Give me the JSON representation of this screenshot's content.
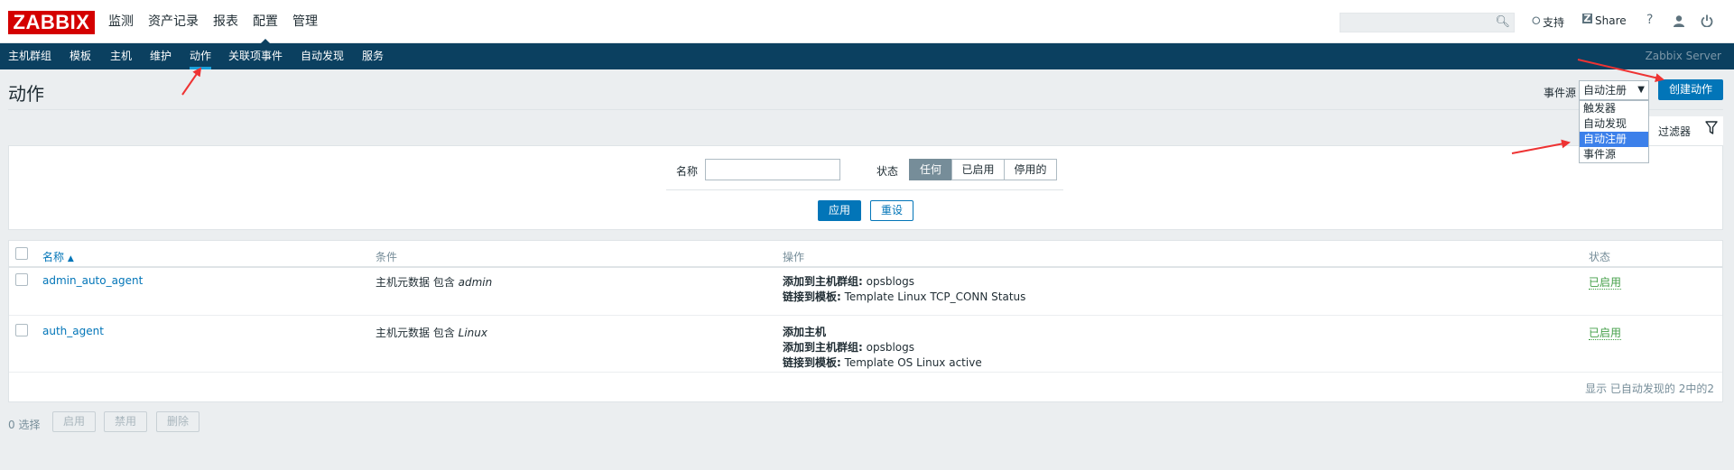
{
  "header": {
    "logo": "ZABBIX",
    "nav": [
      "监测",
      "资产记录",
      "报表",
      "配置",
      "管理"
    ],
    "active_nav": "配置",
    "support": "支持",
    "share": "Share",
    "help": "?"
  },
  "subnav": {
    "items": [
      "主机群组",
      "模板",
      "主机",
      "维护",
      "动作",
      "关联项事件",
      "自动发现",
      "服务"
    ],
    "active": "动作",
    "server_name": "Zabbix Server"
  },
  "page": {
    "title": "动作",
    "event_source_label": "事件源",
    "event_source_selected": "自动注册",
    "event_source_options": [
      "触发器",
      "自动发现",
      "自动注册",
      "事件源"
    ],
    "create_button": "创建动作"
  },
  "filter": {
    "tab_label": "过滤器",
    "name_label": "名称",
    "name_value": "",
    "status_label": "状态",
    "status_options": [
      "任何",
      "已启用",
      "停用的"
    ],
    "status_selected": "任何",
    "apply": "应用",
    "reset": "重设"
  },
  "table": {
    "columns": [
      "名称",
      "条件",
      "操作",
      "状态"
    ],
    "rows": [
      {
        "name": "admin_auto_agent",
        "condition_prefix": "主机元数据 包含 ",
        "condition_value": "admin",
        "operations": [
          {
            "label": "添加到主机群组:",
            "value": " opsblogs"
          },
          {
            "label": "链接到模板:",
            "value": " Template Linux TCP_CONN Status"
          }
        ],
        "status": "已启用"
      },
      {
        "name": "auth_agent",
        "condition_prefix": "主机元数据 包含 ",
        "condition_value": "Linux",
        "operations": [
          {
            "label": "添加主机",
            "value": ""
          },
          {
            "label": "添加到主机群组:",
            "value": " opsblogs"
          },
          {
            "label": "链接到模板:",
            "value": " Template OS Linux active"
          }
        ],
        "status": "已启用"
      }
    ],
    "footer": "显示 已自动发现的 2中的2"
  },
  "mass_actions": {
    "selected": "0 选择",
    "enable": "启用",
    "disable": "禁用",
    "delete": "删除"
  },
  "colors": {
    "brand_red": "#d40000",
    "nav_dark": "#0b4060",
    "primary_blue": "#0275b8",
    "enabled_green": "#429e47",
    "annotation_arrow": "#ee3333"
  }
}
